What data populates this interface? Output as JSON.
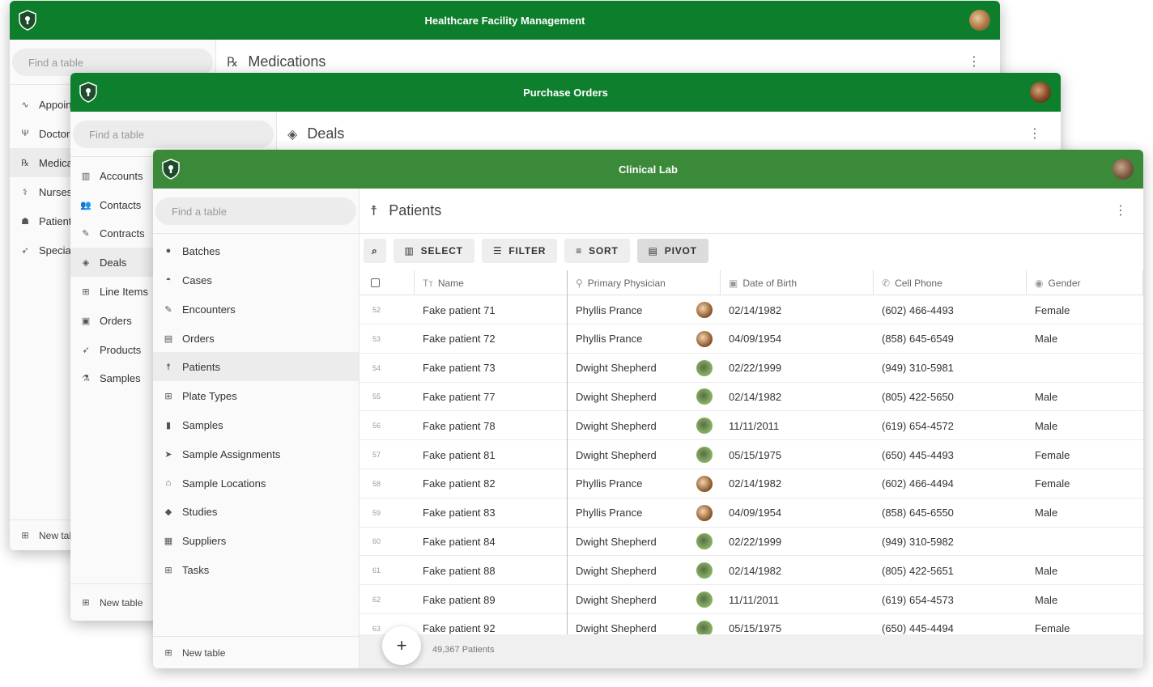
{
  "colors": {
    "header_green_1": "#0d7f2c",
    "header_green_2": "#0e7f2d",
    "header_green_3": "#3b8a3a"
  },
  "windows": [
    {
      "title": "Healthcare Facility Management",
      "search_placeholder": "Find a table",
      "table_title": "Medications",
      "nav": [
        "Appointments",
        "Doctors",
        "Medications",
        "Nurses",
        "Patients",
        "Specialties"
      ],
      "nav_active": "Medications",
      "new_table": "New table"
    },
    {
      "title": "Purchase Orders",
      "search_placeholder": "Find a table",
      "table_title": "Deals",
      "nav": [
        "Accounts",
        "Contacts",
        "Contracts",
        "Deals",
        "Line Items",
        "Orders",
        "Products",
        "Samples"
      ],
      "nav_active": "Deals",
      "new_table": "New table"
    },
    {
      "title": "Clinical Lab",
      "search_placeholder": "Find a table",
      "table_title": "Patients",
      "nav": [
        "Batches",
        "Cases",
        "Encounters",
        "Orders",
        "Patients",
        "Plate Types",
        "Samples",
        "Sample Assignments",
        "Sample Locations",
        "Studies",
        "Suppliers",
        "Tasks"
      ],
      "nav_active": "Patients",
      "new_table": "New table",
      "toolbar": {
        "select": "SELECT",
        "filter": "FILTER",
        "sort": "SORT",
        "pivot": "PIVOT"
      },
      "columns": [
        "Name",
        "Primary Physician",
        "Date of Birth",
        "Cell Phone",
        "Gender"
      ],
      "rows": [
        {
          "n": "52",
          "name": "Fake patient 71",
          "physician": "Phyllis Prance",
          "dob": "02/14/1982",
          "phone": "(602) 466-4493",
          "gender": "Female"
        },
        {
          "n": "53",
          "name": "Fake patient 72",
          "physician": "Phyllis Prance",
          "dob": "04/09/1954",
          "phone": "(858) 645-6549",
          "gender": "Male"
        },
        {
          "n": "54",
          "name": "Fake patient 73",
          "physician": "Dwight Shepherd",
          "dob": "02/22/1999",
          "phone": "(949) 310-5981",
          "gender": ""
        },
        {
          "n": "55",
          "name": "Fake patient 77",
          "physician": "Dwight Shepherd",
          "dob": "02/14/1982",
          "phone": "(805) 422-5650",
          "gender": "Male"
        },
        {
          "n": "56",
          "name": "Fake patient 78",
          "physician": "Dwight Shepherd",
          "dob": "11/11/2011",
          "phone": "(619) 654-4572",
          "gender": "Male"
        },
        {
          "n": "57",
          "name": "Fake patient 81",
          "physician": "Dwight Shepherd",
          "dob": "05/15/1975",
          "phone": "(650) 445-4493",
          "gender": "Female"
        },
        {
          "n": "58",
          "name": "Fake patient 82",
          "physician": "Phyllis Prance",
          "dob": "02/14/1982",
          "phone": "(602) 466-4494",
          "gender": "Female"
        },
        {
          "n": "59",
          "name": "Fake patient 83",
          "physician": "Phyllis Prance",
          "dob": "04/09/1954",
          "phone": "(858) 645-6550",
          "gender": "Male"
        },
        {
          "n": "60",
          "name": "Fake patient 84",
          "physician": "Dwight Shepherd",
          "dob": "02/22/1999",
          "phone": "(949) 310-5982",
          "gender": ""
        },
        {
          "n": "61",
          "name": "Fake patient 88",
          "physician": "Dwight Shepherd",
          "dob": "02/14/1982",
          "phone": "(805) 422-5651",
          "gender": "Male"
        },
        {
          "n": "62",
          "name": "Fake patient 89",
          "physician": "Dwight Shepherd",
          "dob": "11/11/2011",
          "phone": "(619) 654-4573",
          "gender": "Male"
        },
        {
          "n": "63",
          "name": "Fake patient 92",
          "physician": "Dwight Shepherd",
          "dob": "05/15/1975",
          "phone": "(650) 445-4494",
          "gender": "Female"
        }
      ],
      "count_label": "49,367 Patients",
      "add_label": "+"
    }
  ]
}
